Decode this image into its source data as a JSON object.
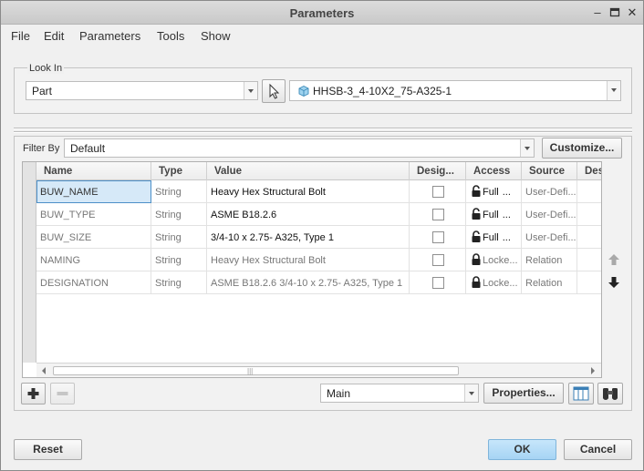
{
  "window": {
    "title": "Parameters"
  },
  "menu": [
    "File",
    "Edit",
    "Parameters",
    "Tools",
    "Show"
  ],
  "look_in": {
    "label": "Look In",
    "scope": "Part",
    "model": "HHSB-3_4-10X2_75-A325-1"
  },
  "filter": {
    "label": "Filter By",
    "value": "Default",
    "customize_label": "Customize..."
  },
  "table": {
    "columns": [
      "Name",
      "Type",
      "Value",
      "Desig...",
      "Access",
      "Source",
      "Des"
    ],
    "rows": [
      {
        "name": "BUW_NAME",
        "type": "String",
        "value": "Heavy Hex Structural Bolt",
        "designated": false,
        "access": "Full",
        "access_suffix": "...",
        "source": "User-Defi...",
        "selected": true,
        "editable": true
      },
      {
        "name": "BUW_TYPE",
        "type": "String",
        "value": "ASME B18.2.6",
        "designated": false,
        "access": "Full",
        "access_suffix": "...",
        "source": "User-Defi...",
        "selected": false,
        "editable": true
      },
      {
        "name": "BUW_SIZE",
        "type": "String",
        "value": "3/4-10 x 2.75- A325, Type 1",
        "designated": false,
        "access": "Full",
        "access_suffix": "...",
        "source": "User-Defi...",
        "selected": false,
        "editable": true
      },
      {
        "name": "NAMING",
        "type": "String",
        "value": "Heavy Hex Structural Bolt",
        "designated": false,
        "access": "Locke...",
        "access_suffix": "",
        "source": "Relation",
        "selected": false,
        "editable": false
      },
      {
        "name": "DESIGNATION",
        "type": "String",
        "value": "ASME B18.2.6 3/4-10 x 2.75- A325, Type 1",
        "designated": false,
        "access": "Locke...",
        "access_suffix": "",
        "source": "Relation",
        "selected": false,
        "editable": false
      }
    ]
  },
  "bottom_toolbar": {
    "view_select": "Main",
    "properties_label": "Properties..."
  },
  "footer": {
    "reset_label": "Reset",
    "ok_label": "OK",
    "cancel_label": "Cancel"
  }
}
